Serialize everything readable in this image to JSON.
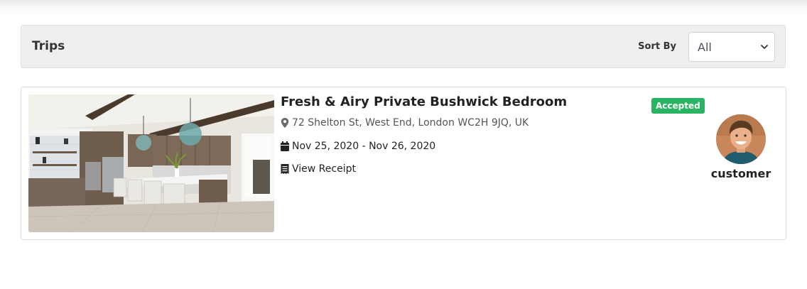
{
  "header": {
    "title": "Trips",
    "sort_label": "Sort By",
    "sort_value": "All"
  },
  "trip": {
    "title": "Fresh & Airy Private Bushwick Bedroom",
    "address": "72 Shelton St, West End, London WC2H 9JQ, UK",
    "dates": "Nov 25, 2020 - Nov 26, 2020",
    "receipt_label": "View Receipt",
    "status": "Accepted",
    "host_name": "customer",
    "photo_icon": "kitchen-photo",
    "address_icon": "map-marker-icon",
    "dates_icon": "calendar-icon",
    "receipt_icon": "receipt-icon"
  },
  "colors": {
    "status_accepted": "#28b463",
    "header_bg": "#efefef"
  }
}
